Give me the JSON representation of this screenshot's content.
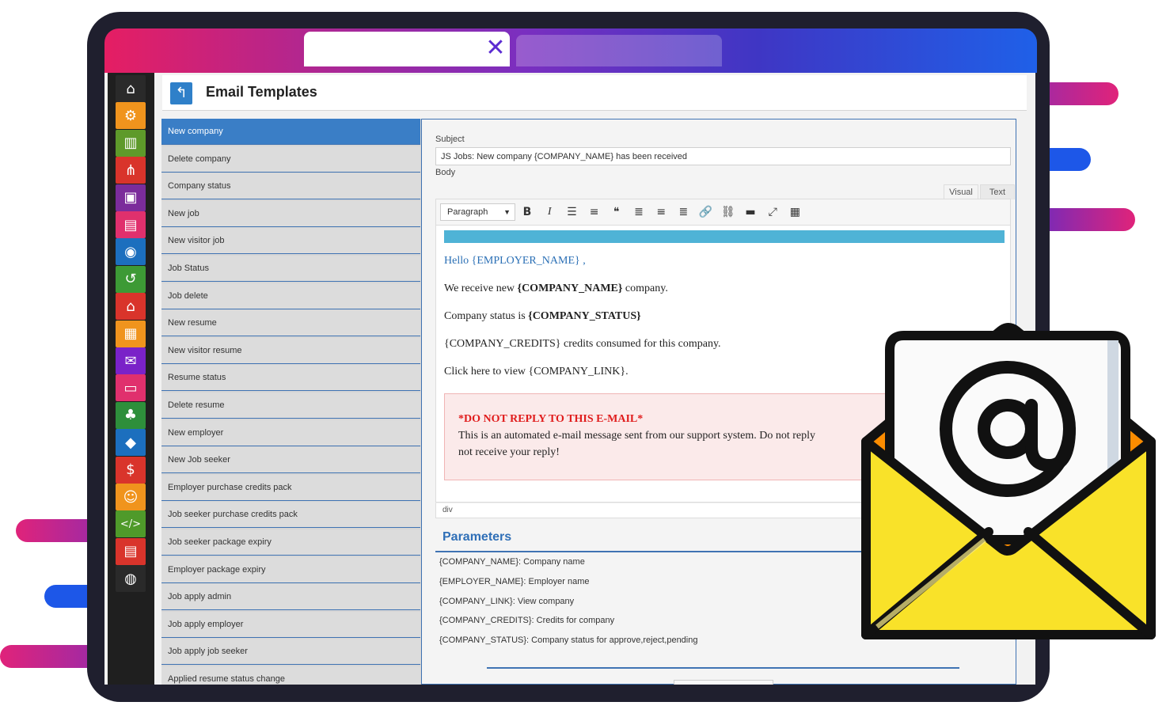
{
  "page": {
    "title": "Email Templates",
    "back_icon": "back-arrow-icon"
  },
  "sidebar": {
    "items": [
      {
        "icon": "home-icon",
        "color": "#2a2a2a"
      },
      {
        "icon": "gear-icon",
        "color": "#f0941d"
      },
      {
        "icon": "building-icon",
        "color": "#5e9a2a"
      },
      {
        "icon": "hierarchy-icon",
        "color": "#d9342b"
      },
      {
        "icon": "briefcase-icon",
        "color": "#7b2c9b"
      },
      {
        "icon": "resume-icon",
        "color": "#e0306d"
      },
      {
        "icon": "coins-icon",
        "color": "#1c6fbe"
      },
      {
        "icon": "history-icon",
        "color": "#3d9a35"
      },
      {
        "icon": "office-icon",
        "color": "#d9342b"
      },
      {
        "icon": "report-icon",
        "color": "#f0941d"
      },
      {
        "icon": "messages-icon",
        "color": "#7a22c8"
      },
      {
        "icon": "folder-icon",
        "color": "#e0306d"
      },
      {
        "icon": "tree-icon",
        "color": "#2e8f3b"
      },
      {
        "icon": "tag-icon",
        "color": "#1c6fbe"
      },
      {
        "icon": "dollar-icon",
        "color": "#d9342b"
      },
      {
        "icon": "users-icon",
        "color": "#f0941d"
      },
      {
        "icon": "code-icon",
        "color": "#4f9a2a"
      },
      {
        "icon": "inbox-icon",
        "color": "#d9342b"
      },
      {
        "icon": "globe-icon",
        "color": "#2a2a2a"
      }
    ]
  },
  "templates": [
    "New company",
    "Delete company",
    "Company status",
    "New job",
    "New visitor job",
    "Job Status",
    "Job delete",
    "New resume",
    "New visitor resume",
    "Resume status",
    "Delete resume",
    "New employer",
    "New Job seeker",
    "Employer purchase credits pack",
    "Job seeker purchase credits pack",
    "Job seeker package expiry",
    "Employer package expiry",
    "Job apply admin",
    "Job apply employer",
    "Job apply job seeker",
    "Applied resume status change"
  ],
  "form": {
    "subject_label": "Subject",
    "subject_value": "JS Jobs: New company {COMPANY_NAME} has been received",
    "body_label": "Body",
    "tab_visual": "Visual",
    "tab_text": "Text",
    "format_select": "Paragraph",
    "toolbar": [
      "bold-icon",
      "italic-icon",
      "bullet-list-icon",
      "numbered-list-icon",
      "quote-icon",
      "align-left-icon",
      "align-center-icon",
      "align-right-icon",
      "link-icon",
      "unlink-icon",
      "read-more-icon",
      "fullscreen-icon",
      "toolbar-toggle-icon"
    ],
    "status_path": "div"
  },
  "email": {
    "greeting": "Hello {EMPLOYER_NAME} ,",
    "line1_pre": "We receive new ",
    "line1_bold": "{COMPANY_NAME}",
    "line1_post": " company.",
    "line2_pre": "Company status is ",
    "line2_bold": "{COMPANY_STATUS}",
    "line3": "{COMPANY_CREDITS} credits consumed for this company.",
    "line4": "Click here to view {COMPANY_LINK}.",
    "notice_title": "*DO NOT REPLY TO THIS E-MAIL*",
    "notice_line1": "This is an automated e-mail message sent from our support system. Do not reply",
    "notice_line2": "not receive your reply!"
  },
  "parameters": {
    "title": "Parameters",
    "items": [
      "{COMPANY_NAME}: Company name",
      "{EMPLOYER_NAME}: Employer name",
      "{COMPANY_LINK}: View company",
      "{COMPANY_CREDITS}: Credits for company",
      "{COMPANY_STATUS}: Company status for approve,reject,pending"
    ]
  },
  "colors": {
    "accent": "#3a7ec6",
    "brand_gradient_start": "#e51e63",
    "brand_gradient_end": "#1f60e8",
    "envelope_yellow": "#f9e229",
    "envelope_orange": "#fb8c00"
  }
}
